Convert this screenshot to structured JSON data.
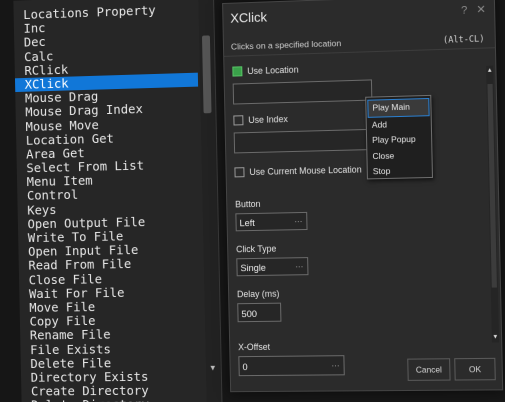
{
  "command_list": {
    "items": [
      "Locations Property",
      "Inc",
      "Dec",
      "Calc",
      "RClick",
      "XClick",
      "Mouse Drag",
      "Mouse Drag Index",
      "Mouse Move",
      "Location Get",
      "Area Get",
      "Select From List",
      "Menu Item",
      "Control",
      "Keys",
      "Open Output File",
      "Write To File",
      "Open Input File",
      "Read From File",
      "Close File",
      "Wait For File",
      "Move File",
      "Copy File",
      "Rename File",
      "File Exists",
      "Delete File",
      "Directory Exists",
      "Create Directory",
      "Delete Directory"
    ],
    "selected_index": 5,
    "scroll_down_glyph": "▼"
  },
  "dialog": {
    "title": "XClick",
    "help_glyph": "?",
    "close_glyph": "✕",
    "description": "Clicks on a specified location",
    "hotkey": "(Alt-CL)",
    "use_location": {
      "label": "Use Location",
      "checked": true,
      "value": ""
    },
    "use_index": {
      "label": "Use Index",
      "checked": false,
      "value": ""
    },
    "use_current": {
      "label": "Use Current Mouse Location",
      "checked": false
    },
    "button": {
      "label": "Button",
      "value": "Left",
      "arrow": "···"
    },
    "click_type": {
      "label": "Click Type",
      "value": "Single",
      "arrow": "···"
    },
    "delay": {
      "label": "Delay (ms)",
      "value": "500"
    },
    "x_offset": {
      "label": "X-Offset",
      "value": "0",
      "arrow": "···"
    },
    "scroll_up_glyph": "▲",
    "scroll_down_glyph": "▼",
    "cancel_label": "Cancel",
    "ok_label": "OK"
  },
  "popup_menu": {
    "items": [
      "Play Main",
      "Add",
      "Play Popup",
      "Close",
      "Stop"
    ],
    "highlighted_index": 0
  },
  "colors": {
    "selection": "#1177d8",
    "checked": "#3aa14a",
    "menu_highlight_border": "#2a7fd0"
  }
}
